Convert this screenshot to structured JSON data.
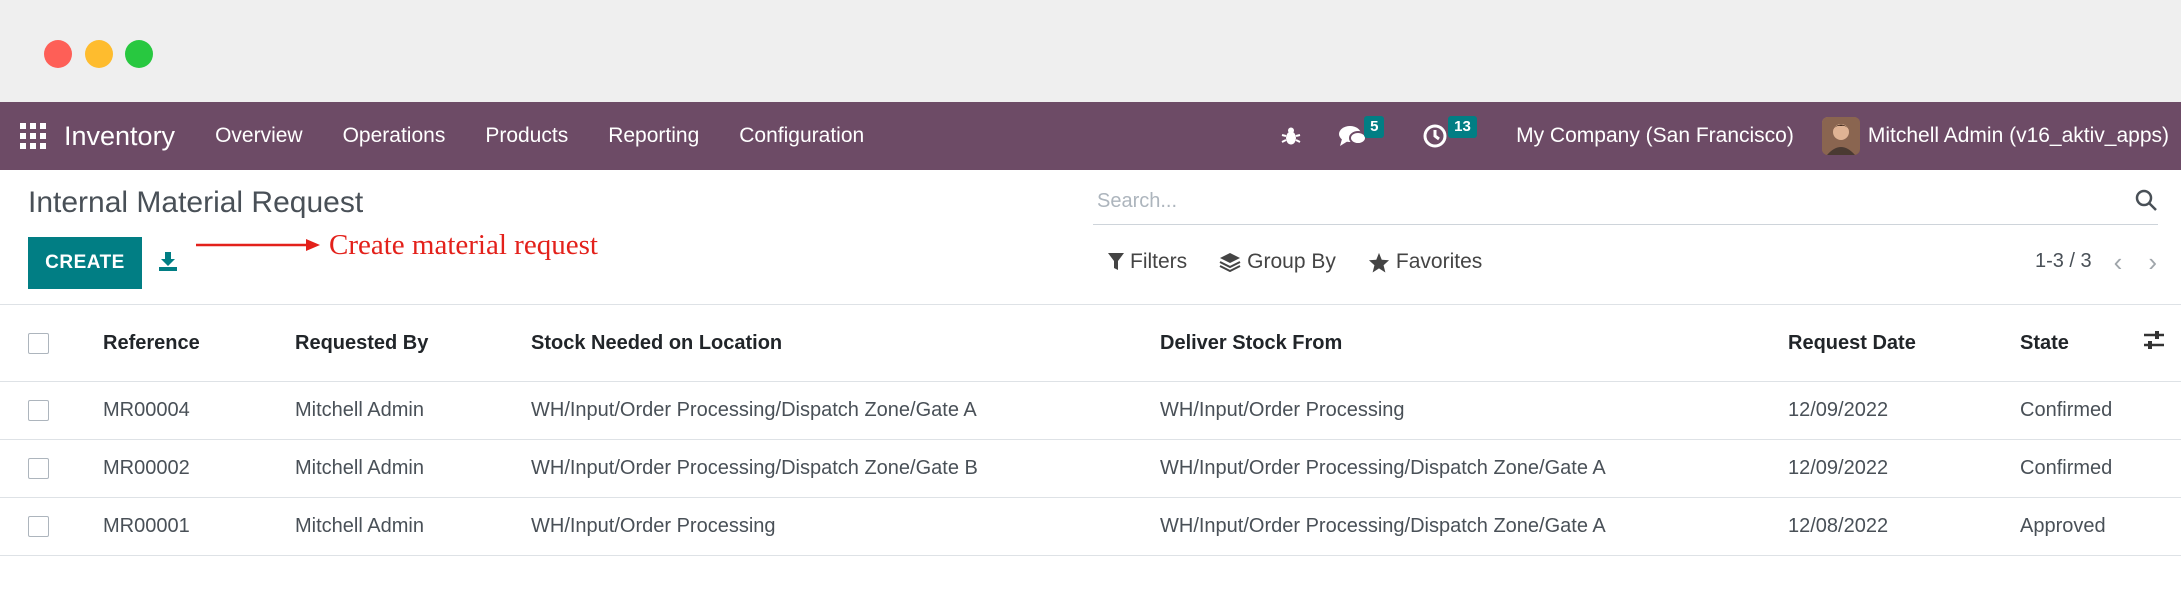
{
  "navbar": {
    "app_name": "Inventory",
    "menu": [
      "Overview",
      "Operations",
      "Products",
      "Reporting",
      "Configuration"
    ],
    "messages_count": "5",
    "activities_count": "13",
    "company": "My Company (San Francisco)",
    "user": "Mitchell Admin (v16_aktiv_apps)"
  },
  "control": {
    "title": "Internal Material Request",
    "create_label": "CREATE",
    "annotation": "Create material request",
    "search_placeholder": "Search...",
    "filters_label": "Filters",
    "groupby_label": "Group By",
    "favorites_label": "Favorites",
    "pager": "1-3 / 3"
  },
  "table": {
    "headers": [
      "Reference",
      "Requested By",
      "Stock Needed on Location",
      "Deliver Stock From",
      "Request Date",
      "State"
    ],
    "rows": [
      [
        "MR00004",
        "Mitchell Admin",
        "WH/Input/Order Processing/Dispatch Zone/Gate A",
        "WH/Input/Order Processing",
        "12/09/2022",
        "Confirmed"
      ],
      [
        "MR00002",
        "Mitchell Admin",
        "WH/Input/Order Processing/Dispatch Zone/Gate B",
        "WH/Input/Order Processing/Dispatch Zone/Gate A",
        "12/09/2022",
        "Confirmed"
      ],
      [
        "MR00001",
        "Mitchell Admin",
        "WH/Input/Order Processing",
        "WH/Input/Order Processing/Dispatch Zone/Gate A",
        "12/08/2022",
        "Approved"
      ]
    ]
  },
  "colors": {
    "navbar": "#6d4b66",
    "primary": "#017e84",
    "annotation": "#e3211b"
  }
}
